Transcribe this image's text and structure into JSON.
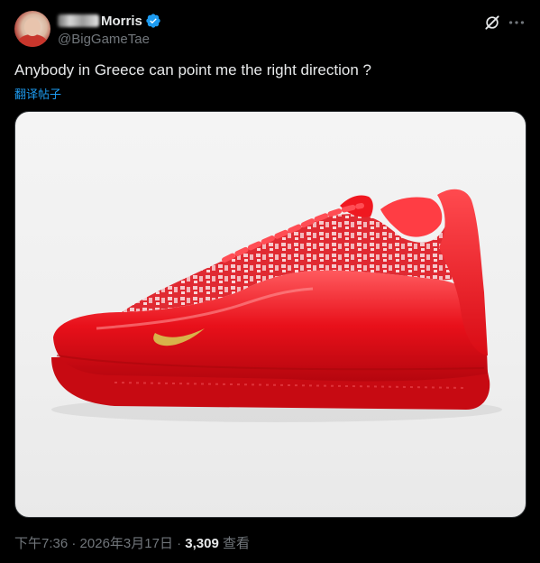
{
  "author": {
    "display_name": "Morris",
    "handle": "@BigGameTae",
    "verified": true
  },
  "icons": {
    "avatar": "user-avatar",
    "verified": "verified-badge-icon",
    "grok": "grok-icon",
    "more": "more-icon",
    "media": "red-basketball-shoe-image"
  },
  "tweet": {
    "text": "Anybody in Greece can point me the right direction ?",
    "translate_label": "翻译帖子"
  },
  "meta": {
    "time": "下午7:36",
    "separator1": " · ",
    "date": "2026年3月17日",
    "separator2": " · ",
    "views": "3,309",
    "views_label": " 查看"
  },
  "colors": {
    "background": "#000000",
    "text": "#e7e9ea",
    "secondary": "#71767b",
    "accent": "#1d9bf0",
    "shoe_red": "#e8101a"
  }
}
